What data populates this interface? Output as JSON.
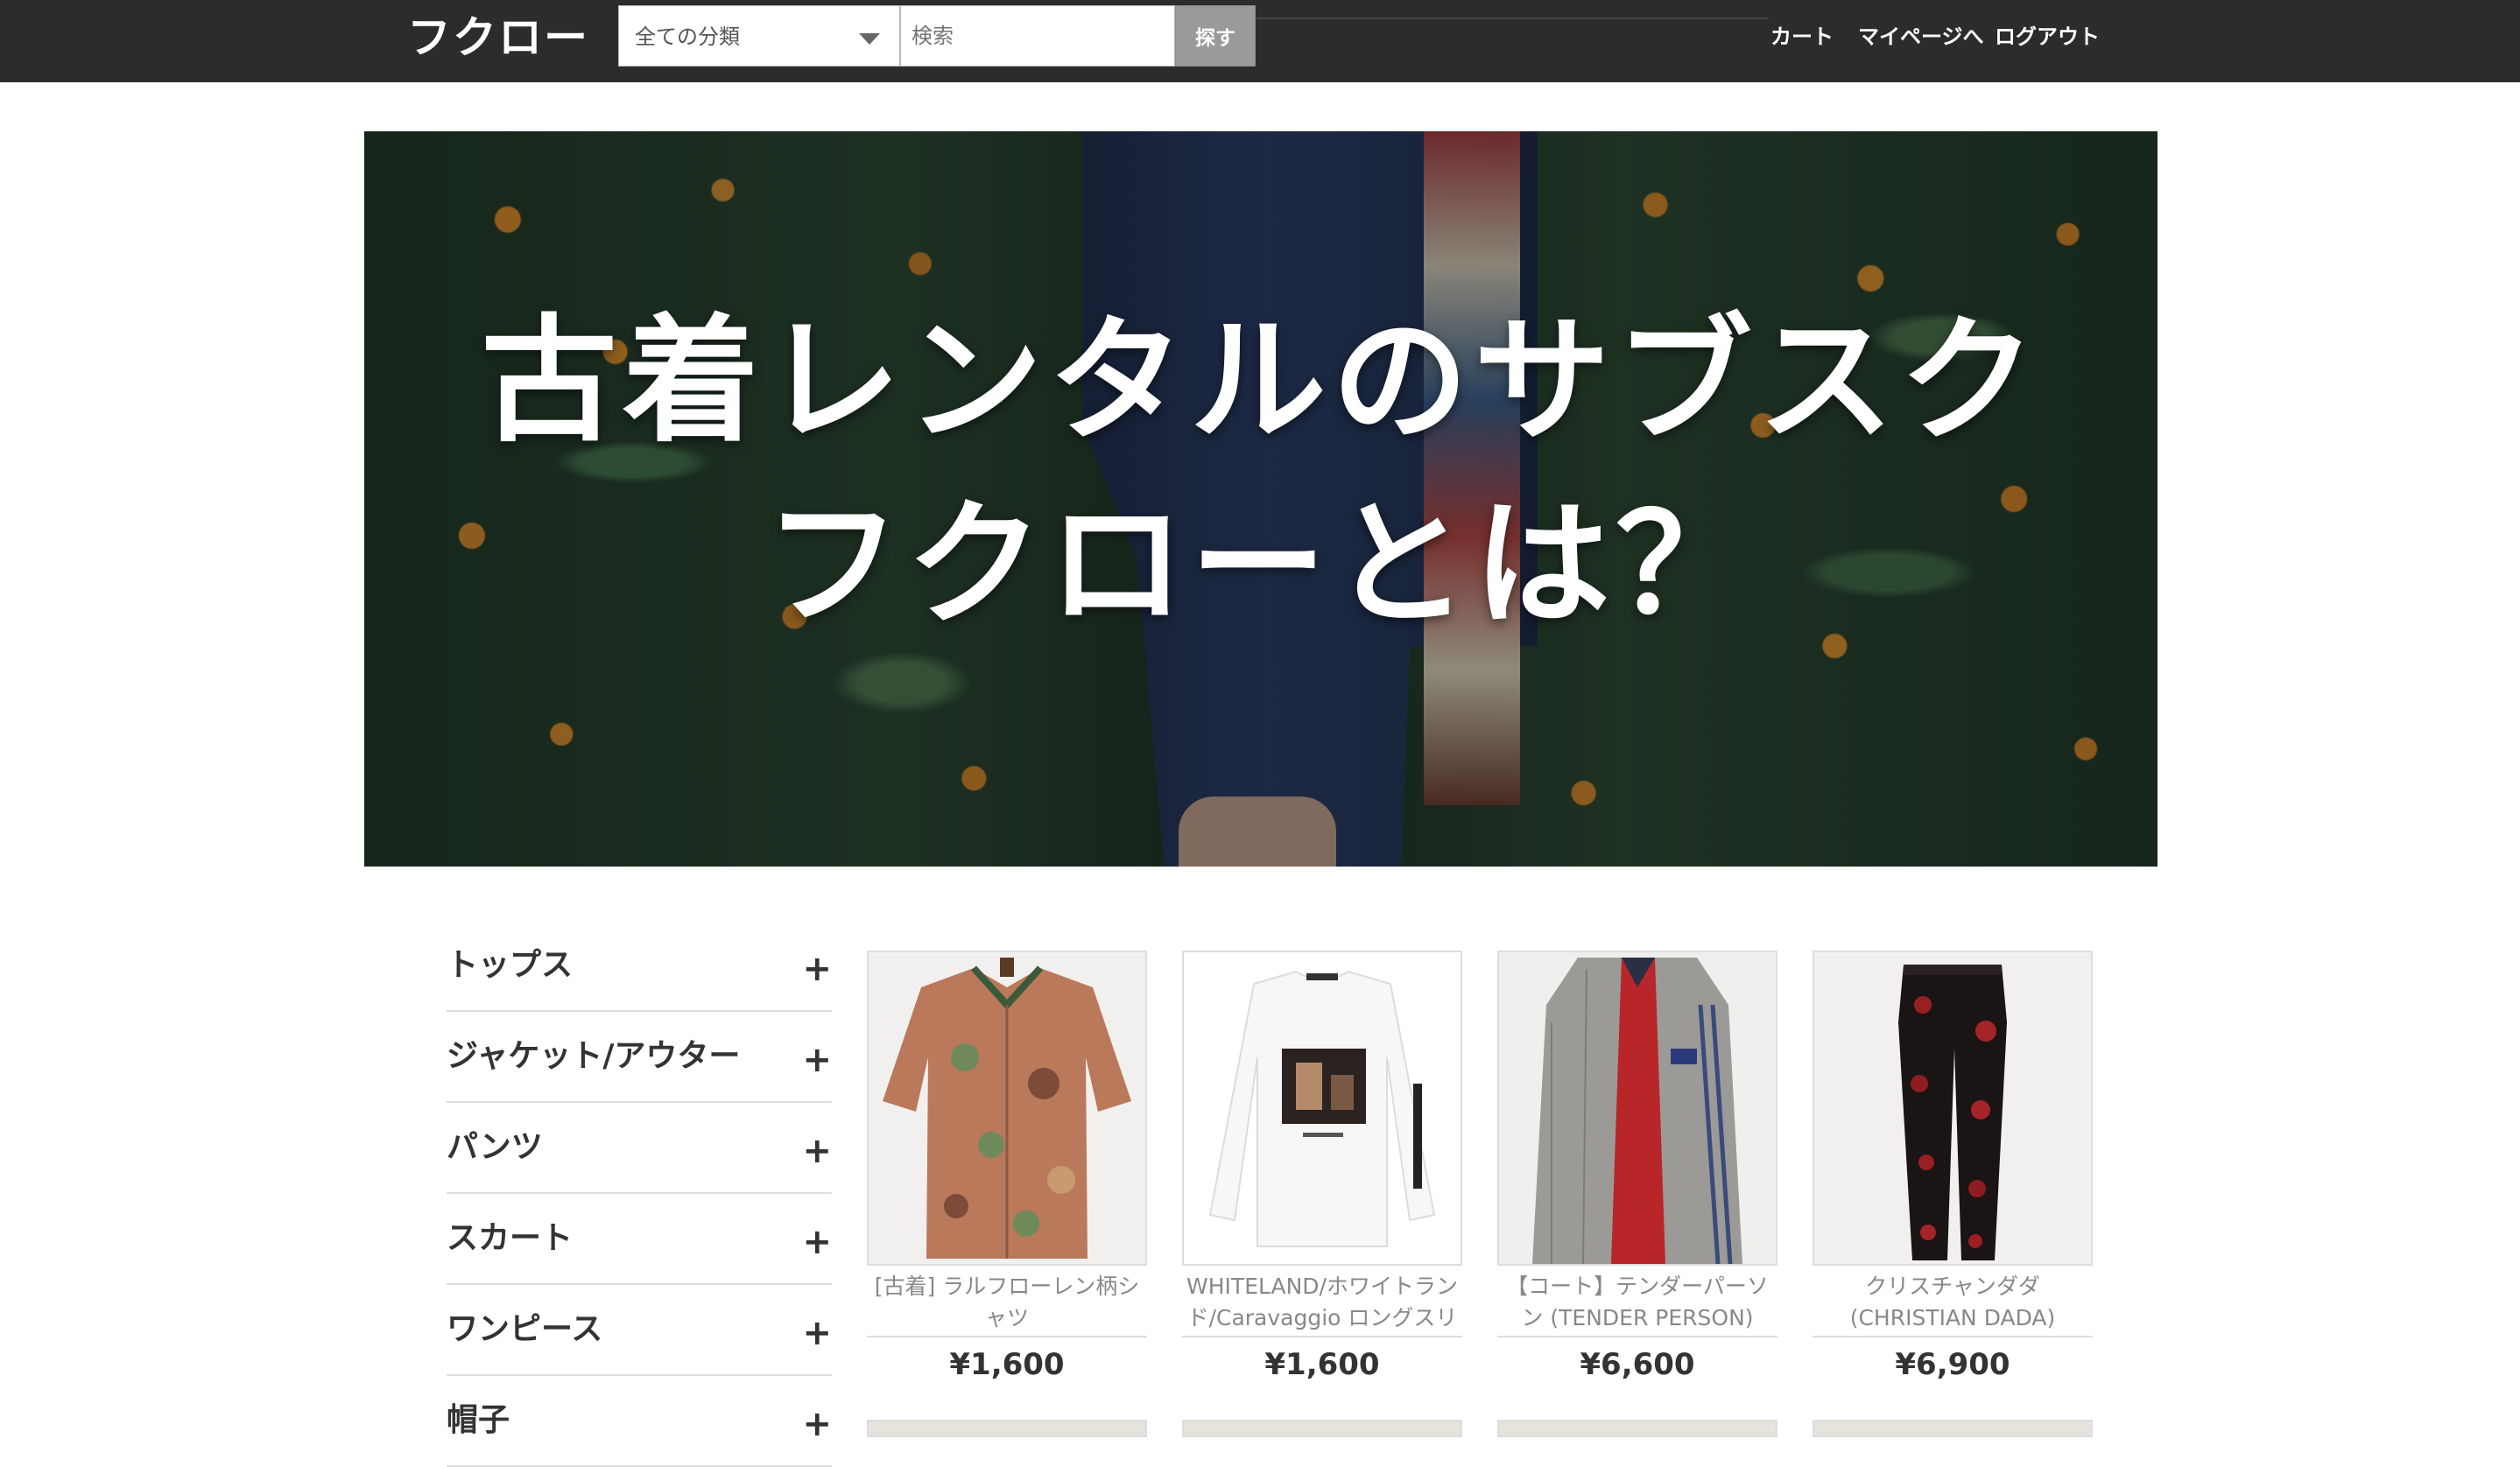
{
  "header": {
    "logo": "フクロー",
    "category_select": "全ての分類",
    "search_placeholder": "検索",
    "search_button": "探す",
    "nav": [
      "カート",
      "マイページへ",
      "ログアウト"
    ]
  },
  "hero": {
    "line1": "古着レンタルのサブスク",
    "line2": "フクローとは？"
  },
  "sidebar": {
    "items": [
      {
        "label": "トップス",
        "icon": "plus-icon"
      },
      {
        "label": "ジャケット/アウター",
        "icon": "plus-icon"
      },
      {
        "label": "パンツ",
        "icon": "plus-icon"
      },
      {
        "label": "スカート",
        "icon": "plus-icon"
      },
      {
        "label": "ワンピース",
        "icon": "plus-icon"
      },
      {
        "label": "帽子",
        "icon": "plus-icon"
      }
    ]
  },
  "products": [
    {
      "name": "[古着] ラルフローレン柄シャツ",
      "price": "¥1,600"
    },
    {
      "name": "WHITELAND/ホワイトランド/Caravaggio ロングスリーブ",
      "price": "¥1,600"
    },
    {
      "name": "【コート】テンダーパーソン (TENDER PERSON)",
      "price": "¥6,600"
    },
    {
      "name": "クリスチャンダダ (CHRISTIAN DADA)",
      "price": "¥6,900"
    }
  ],
  "colors": {
    "header_bg": "#2c2c2c",
    "search_button_bg": "#9a9a9a"
  }
}
